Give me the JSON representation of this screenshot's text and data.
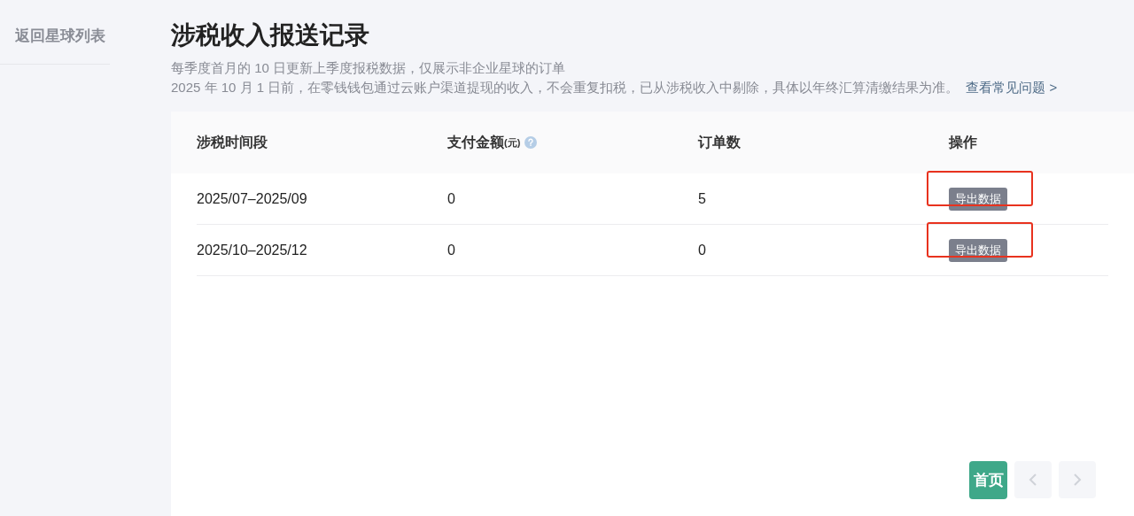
{
  "sidebar": {
    "back_link": "返回星球列表"
  },
  "page": {
    "title": "涉税收入报送记录",
    "notes": [
      "每季度首月的 10 日更新上季度报税数据，仅展示非企业星球的订单",
      "2025 年 10 月 1 日前，在零钱钱包通过云账户渠道提现的收入，不会重复扣税，已从涉税收入中剔除，具体以年终汇算清缴结果为准。"
    ],
    "faq_link": "查看常见问题 >"
  },
  "table": {
    "columns": [
      {
        "label": "涉税时间段"
      },
      {
        "label": "支付金额",
        "unit": "(元)",
        "help": true
      },
      {
        "label": "订单数"
      },
      {
        "label": "操作"
      }
    ],
    "rows": [
      {
        "period": "2025/07–2025/09",
        "amount": "0",
        "orders": "5",
        "action": "导出数据",
        "highlighted": true
      },
      {
        "period": "2025/10–2025/12",
        "amount": "0",
        "orders": "0",
        "action": "导出数据",
        "highlighted": true
      }
    ]
  },
  "pagination": {
    "first": {
      "label": "首页",
      "disabled": false
    },
    "prev": {
      "disabled": true
    },
    "next": {
      "disabled": true
    }
  }
}
